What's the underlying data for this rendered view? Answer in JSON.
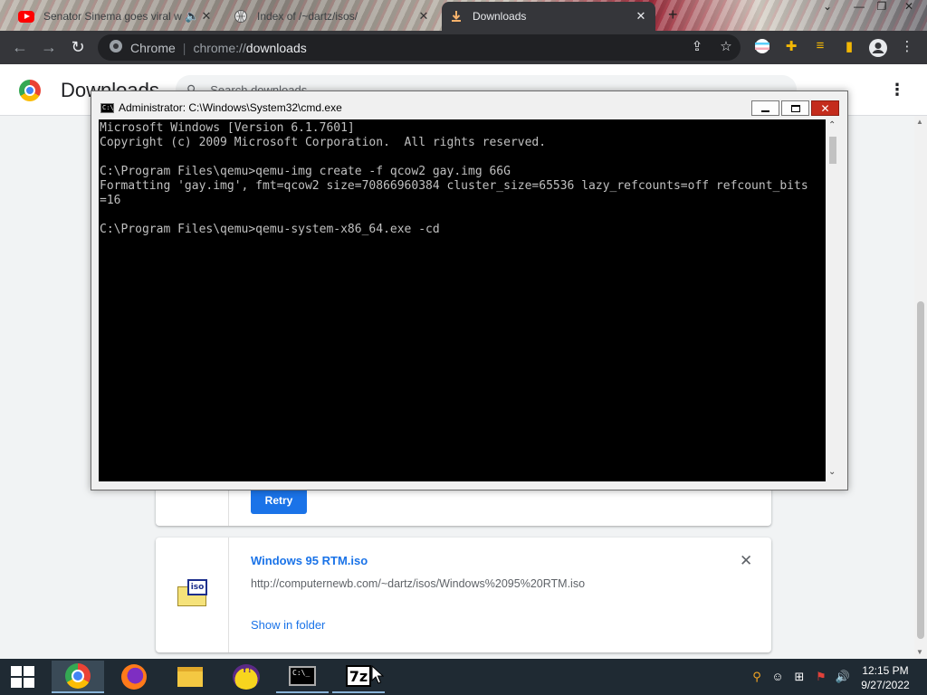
{
  "browser": {
    "tabs": [
      {
        "title": "Senator Sinema goes viral w",
        "close": "✕"
      },
      {
        "title": "Index of /~dartz/isos/",
        "close": "✕"
      },
      {
        "title": "Downloads",
        "close": "✕"
      }
    ],
    "new_tab": "+",
    "omnibox": {
      "site": "Chrome",
      "scheme": "chrome://",
      "path": "downloads"
    }
  },
  "downloads_page": {
    "title": "Downloads",
    "search_placeholder": "Search downloads",
    "item1": {
      "retry_label": "Retry"
    },
    "item2": {
      "filename": "Windows 95 RTM.iso",
      "url": "http://computernewb.com/~dartz/isos/Windows%2095%20RTM.iso",
      "show_in_folder": "Show in folder",
      "icon_label": "iso"
    }
  },
  "cmd_window": {
    "title": "Administrator: C:\\Windows\\System32\\cmd.exe",
    "lines": [
      "Microsoft Windows [Version 6.1.7601]",
      "Copyright (c) 2009 Microsoft Corporation.  All rights reserved.",
      "",
      "C:\\Program Files\\qemu>qemu-img create -f qcow2 gay.img 66G",
      "Formatting 'gay.img', fmt=qcow2 size=70866960384 cluster_size=65536 lazy_refcounts=off refcount_bits",
      "=16",
      "",
      "C:\\Program Files\\qemu>qemu-system-x86_64.exe -cd"
    ]
  },
  "taskbar": {
    "clock_time": "12:15 PM",
    "clock_date": "9/27/2022"
  }
}
